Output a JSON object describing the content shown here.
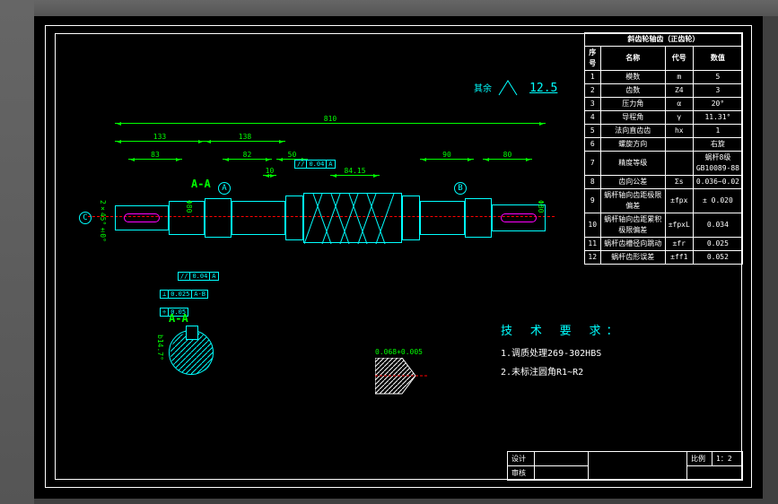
{
  "surface_finish": {
    "label": "其余",
    "value": "12.5"
  },
  "param_table": {
    "header": "斜齿轮轴齿（正齿轮）",
    "cols": [
      "序号",
      "名称",
      "代号",
      "数值"
    ],
    "rows": [
      [
        "1",
        "模数",
        "m",
        "5"
      ],
      [
        "2",
        "齿数",
        "Z4",
        "3"
      ],
      [
        "3",
        "压力角",
        "α",
        "20°"
      ],
      [
        "4",
        "导程角",
        "γ",
        "11.31°"
      ],
      [
        "5",
        "法向直齿齿",
        "hx",
        "1"
      ],
      [
        "6",
        "螺旋方向",
        "",
        "右旋"
      ],
      [
        "7",
        "精度等级",
        "",
        "蜗杆8级GB10089-88"
      ],
      [
        "8",
        "齿向公差",
        "Σs",
        "0.036~0.02"
      ],
      [
        "9",
        "蜗杆轴向齿距极限偏差",
        "±fpx",
        "± 0.020"
      ],
      [
        "10",
        "蜗杆轴向齿距累积极限偏差",
        "±fpxL",
        "0.034"
      ],
      [
        "11",
        "蜗杆齿槽径向跳动",
        "±fr",
        "0.025"
      ],
      [
        "12",
        "蜗杆齿形误差",
        "±ff1",
        "0.052"
      ]
    ]
  },
  "tech_req": {
    "header": "技 术 要 求：",
    "items": [
      "1.调质处理269-302HBS",
      "2.未标注圆角R1~R2"
    ]
  },
  "dimensions": {
    "overall": "810",
    "d1": "133",
    "d2": "83",
    "d3": "138",
    "d4": "82",
    "d5": "50",
    "d6": "20",
    "d7": "10",
    "d8": "90",
    "d9": "80",
    "d10": "84.15",
    "dia_small": "2×45°±0°",
    "dia_v1": "Φ80",
    "dia_v2": "Φ80",
    "key_w": "b14.7°"
  },
  "section_labels": {
    "aa": "A-A",
    "detail_aa": "A-A"
  },
  "datums": {
    "a": "A",
    "b": "B",
    "c": "C"
  },
  "gd_tol": {
    "g1": [
      "//",
      "0.04",
      "A"
    ],
    "g2": [
      "//",
      "0.04",
      "A"
    ],
    "g3": [
      "⊥",
      "0.025",
      "A-B"
    ],
    "g4": [
      "÷",
      "0.05"
    ]
  },
  "detail_dim": {
    "angle": "b14.7°",
    "tol": "0.068+0.005"
  },
  "title_block": {
    "rows": [
      [
        "设计",
        "",
        "",
        ""
      ],
      [
        "审核",
        "",
        "",
        ""
      ]
    ],
    "scale_label": "比例",
    "scale_value": "1：2"
  },
  "chart_data": {
    "type": "table",
    "title": "斜齿轮轴齿（正齿轮）",
    "columns": [
      "序号",
      "名称",
      "代号",
      "数值"
    ],
    "rows": [
      {
        "序号": 1,
        "名称": "模数",
        "代号": "m",
        "数值": "5"
      },
      {
        "序号": 2,
        "名称": "齿数",
        "代号": "Z4",
        "数值": "3"
      },
      {
        "序号": 3,
        "名称": "压力角",
        "代号": "α",
        "数值": "20°"
      },
      {
        "序号": 4,
        "名称": "导程角",
        "代号": "γ",
        "数值": "11.31°"
      },
      {
        "序号": 5,
        "名称": "法向直齿齿",
        "代号": "hx",
        "数值": "1"
      },
      {
        "序号": 6,
        "名称": "螺旋方向",
        "代号": "",
        "数值": "右旋"
      },
      {
        "序号": 7,
        "名称": "精度等级",
        "代号": "",
        "数值": "蜗杆8级GB10089-88"
      },
      {
        "序号": 8,
        "名称": "齿向公差",
        "代号": "Σs",
        "数值": "0.036~0.02"
      },
      {
        "序号": 9,
        "名称": "蜗杆轴向齿距极限偏差",
        "代号": "±fpx",
        "数值": "± 0.020"
      },
      {
        "序号": 10,
        "名称": "蜗杆轴向齿距累积极限偏差",
        "代号": "±fpxL",
        "数值": "0.034"
      },
      {
        "序号": 11,
        "名称": "蜗杆齿槽径向跳动",
        "代号": "±fr",
        "数值": "0.025"
      },
      {
        "序号": 12,
        "名称": "蜗杆齿形误差",
        "代号": "±ff1",
        "数值": "0.052"
      }
    ]
  }
}
